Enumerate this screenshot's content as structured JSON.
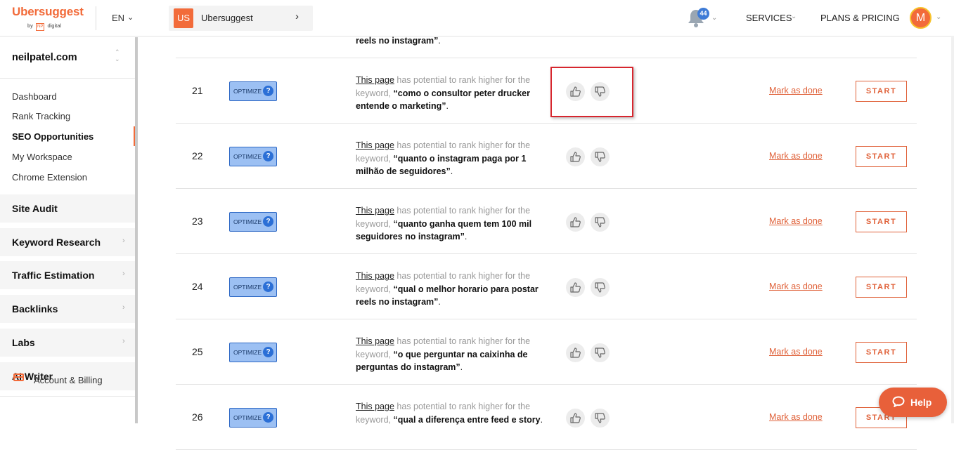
{
  "header": {
    "logo_text": "Ubersuggest",
    "logo_by": "by",
    "logo_np": "NP",
    "logo_digital": "digital",
    "language": "EN",
    "project_badge": "US",
    "project_name": "Ubersuggest",
    "notification_count": "44",
    "services_label": "SERVICES",
    "plans_label": "PLANS & PRICING",
    "avatar_initial": "M"
  },
  "sidebar": {
    "domain": "neilpatel.com",
    "links": [
      "Dashboard",
      "Rank Tracking",
      "SEO Opportunities",
      "My Workspace",
      "Chrome Extension"
    ],
    "active_link": "SEO Opportunities",
    "sections": [
      "Site Audit",
      "Keyword Research",
      "Traffic Estimation",
      "Backlinks",
      "Labs",
      "AI Writer"
    ],
    "billing_label": "Account & Billing"
  },
  "table": {
    "partial_top_keyword": "reels no instagram”",
    "optimize_label": "OPTIMIZE",
    "page_link_text": "This page",
    "desc_text": " has potential to rank higher for the keyword, ",
    "mark_done_label": "Mark as done",
    "start_label": "START",
    "rows": [
      {
        "num": "21",
        "keyword": "“como o consultor peter drucker entende o marketing”"
      },
      {
        "num": "22",
        "keyword": "“quanto o instagram paga por 1 milhão de seguidores”"
      },
      {
        "num": "23",
        "keyword": "“quanto ganha quem tem 100 mil seguidores no instagram”"
      },
      {
        "num": "24",
        "keyword": "“qual o melhor horario para postar reels no instagram”"
      },
      {
        "num": "25",
        "keyword": "“o que perguntar na caixinha de perguntas do instagram”"
      },
      {
        "num": "26",
        "keyword": "“qual a diferença entre feed e story"
      }
    ]
  },
  "help": {
    "label": "Help"
  },
  "colors": {
    "brand": "#f26b3a",
    "optimize_bg": "#9cc0f3",
    "highlight": "#d7262e"
  }
}
